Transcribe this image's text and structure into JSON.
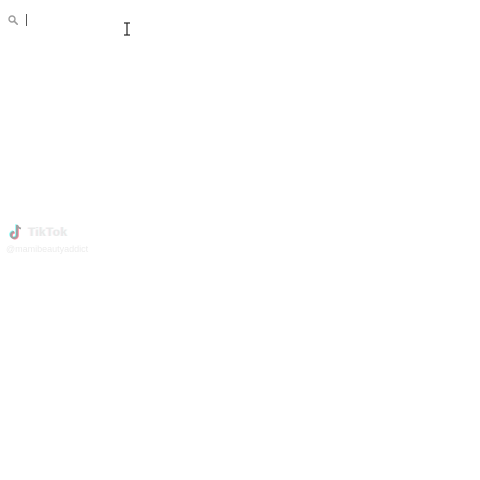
{
  "search": {
    "value": "",
    "placeholder": ""
  },
  "watermark": {
    "brand": "TikTok",
    "handle": "@mamibeautyaddict"
  },
  "colors": {
    "background": "#ffffff",
    "icon": "#9a9a9a",
    "tiktok_cyan": "#25f4ee",
    "tiktok_pink": "#fe2c55"
  },
  "icons": {
    "search": "search-icon",
    "cursor": "i-beam-cursor",
    "logo": "tiktok-logo-icon"
  }
}
